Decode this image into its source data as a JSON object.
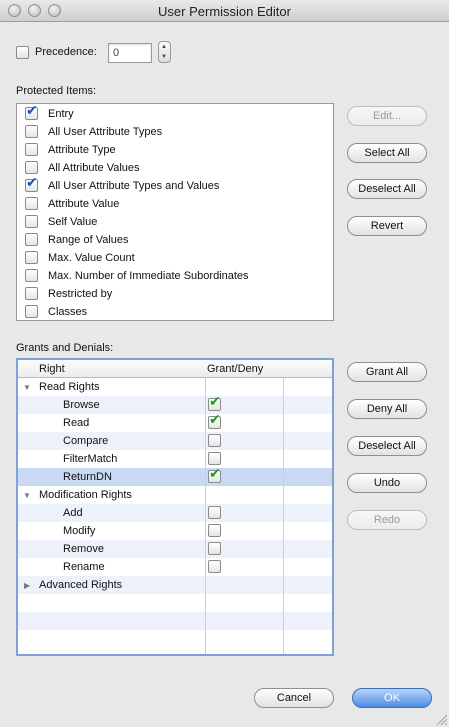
{
  "window": {
    "title": "User Permission Editor"
  },
  "precedence": {
    "label": "Precedence:",
    "value": "0",
    "checked": false
  },
  "protected_items": {
    "label": "Protected Items:",
    "items": [
      {
        "label": "Entry",
        "checked": true
      },
      {
        "label": "All User Attribute Types",
        "checked": false
      },
      {
        "label": "Attribute Type",
        "checked": false
      },
      {
        "label": "All Attribute Values",
        "checked": false
      },
      {
        "label": "All User Attribute Types and Values",
        "checked": true
      },
      {
        "label": "Attribute Value",
        "checked": false
      },
      {
        "label": "Self Value",
        "checked": false
      },
      {
        "label": "Range of Values",
        "checked": false
      },
      {
        "label": "Max. Value Count",
        "checked": false
      },
      {
        "label": "Max. Number of Immediate Subordinates",
        "checked": false
      },
      {
        "label": "Restricted by",
        "checked": false
      },
      {
        "label": "Classes",
        "checked": false
      }
    ],
    "buttons": {
      "edit": "Edit...",
      "select_all": "Select All",
      "deselect_all": "Deselect All",
      "revert": "Revert"
    }
  },
  "grants": {
    "label": "Grants and Denials:",
    "columns": {
      "right": "Right",
      "grant_deny": "Grant/Deny"
    },
    "rows": [
      {
        "label": "Read Rights",
        "group": true,
        "expanded": true
      },
      {
        "label": "Browse",
        "checked": true
      },
      {
        "label": "Read",
        "checked": true
      },
      {
        "label": "Compare",
        "checked": false
      },
      {
        "label": "FilterMatch",
        "checked": false
      },
      {
        "label": "ReturnDN",
        "checked": true,
        "selected": true
      },
      {
        "label": "Modification Rights",
        "group": true,
        "expanded": true
      },
      {
        "label": "Add",
        "checked": false
      },
      {
        "label": "Modify",
        "checked": false
      },
      {
        "label": "Remove",
        "checked": false
      },
      {
        "label": "Rename",
        "checked": false
      },
      {
        "label": "Advanced Rights",
        "group": true,
        "expanded": false
      }
    ],
    "buttons": {
      "grant_all": "Grant All",
      "deny_all": "Deny All",
      "deselect_all": "Deselect All",
      "undo": "Undo",
      "redo": "Redo"
    }
  },
  "footer": {
    "cancel": "Cancel",
    "ok": "OK"
  }
}
